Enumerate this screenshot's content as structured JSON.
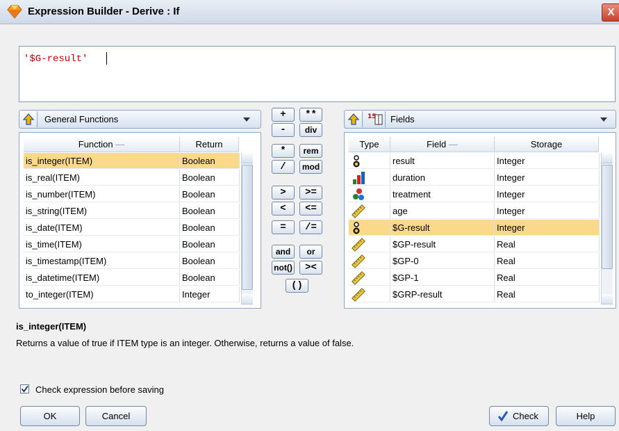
{
  "window": {
    "title": "Expression Builder - Derive : If",
    "close_glyph": "X"
  },
  "expression": {
    "value": "'$G-result'"
  },
  "functions_panel": {
    "category": "General Functions",
    "columns": [
      "Function",
      "Return"
    ],
    "rows": [
      {
        "function": "is_integer(ITEM)",
        "return": "Boolean"
      },
      {
        "function": "is_real(ITEM)",
        "return": "Boolean"
      },
      {
        "function": "is_number(ITEM)",
        "return": "Boolean"
      },
      {
        "function": "is_string(ITEM)",
        "return": "Boolean"
      },
      {
        "function": "is_date(ITEM)",
        "return": "Boolean"
      },
      {
        "function": "is_time(ITEM)",
        "return": "Boolean"
      },
      {
        "function": "is_timestamp(ITEM)",
        "return": "Boolean"
      },
      {
        "function": "is_datetime(ITEM)",
        "return": "Boolean"
      },
      {
        "function": "to_integer(ITEM)",
        "return": "Integer"
      }
    ],
    "selected_index": 0
  },
  "operators": [
    "+",
    "**",
    "-",
    "div",
    "*",
    "rem",
    "/",
    "mod",
    ">",
    ">=",
    "<",
    "<=",
    "=",
    "/=",
    "and",
    "or",
    "not()",
    "><",
    "()"
  ],
  "fields_panel": {
    "category": "Fields",
    "columns": [
      "Type",
      "Field",
      "Storage"
    ],
    "rows": [
      {
        "type_icon": "flag-icon",
        "field": "result",
        "storage": "Integer"
      },
      {
        "type_icon": "continuous-bar-icon",
        "field": "duration",
        "storage": "Integer"
      },
      {
        "type_icon": "nominal-icon",
        "field": "treatment",
        "storage": "Integer"
      },
      {
        "type_icon": "ruler-icon",
        "field": "age",
        "storage": "Integer"
      },
      {
        "type_icon": "flag-icon",
        "field": "$G-result",
        "storage": "Integer"
      },
      {
        "type_icon": "ruler-icon",
        "field": "$GP-result",
        "storage": "Real"
      },
      {
        "type_icon": "ruler-icon",
        "field": "$GP-0",
        "storage": "Real"
      },
      {
        "type_icon": "ruler-icon",
        "field": "$GP-1",
        "storage": "Real"
      },
      {
        "type_icon": "ruler-icon",
        "field": "$GRP-result",
        "storage": "Real"
      }
    ],
    "selected_index": 4
  },
  "description": {
    "title": "is_integer(ITEM)",
    "text": "Returns a value of true if ITEM type is an integer. Otherwise, returns a value of false."
  },
  "check_before_saving": {
    "label": "Check expression before saving",
    "checked": true
  },
  "buttons": {
    "ok": "OK",
    "cancel": "Cancel",
    "check": "Check",
    "help": "Help"
  },
  "colors": {
    "selection": "#fbd98a",
    "expression_text": "#cc0000",
    "accent_border": "#8ea6c5"
  }
}
